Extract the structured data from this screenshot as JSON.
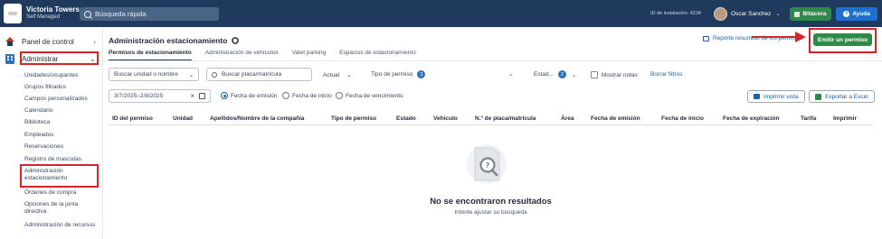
{
  "topbar": {
    "app_name": "Victoria Towers",
    "app_sub": "Self Managed",
    "search_placeholder": "Búsqueda rápida",
    "install_id": "ID de instalación: 4234",
    "user_name": "Oscar Sanchez",
    "bitacora_label": "Bitácora",
    "ayuda_label": "Ayuda",
    "brand_color": "#1f3a5c"
  },
  "sidebar": {
    "panel_label": "Panel de control",
    "admin_label": "Administrar",
    "items": [
      "Unidades/ocupantes",
      "Grupos filtrados",
      "Campos personalizados",
      "Calendario",
      "Biblioteca",
      "Empleados",
      "Reservaciones",
      "Registro de mascotas",
      "Administración estacionamiento",
      "Órdenes de compra",
      "Opciones de la junta directiva",
      "Administración de recursos"
    ]
  },
  "main": {
    "title": "Administración estacionamiento",
    "report_link": "Reporte resumido de los permisos",
    "emit_button": "Emitir un permiso",
    "tabs": [
      "Permisos de estacionamiento",
      "Administración de vehículos",
      "Valet parking",
      "Espacios de estacionamiento"
    ],
    "filters": {
      "unit_select": "Buscar unidad o nombre",
      "plate_search": "Buscar placa/matrícula",
      "actual": "Actual",
      "tipo_permiso": "Tipo de permiso",
      "tipo_count": "3",
      "estado": "Estad...",
      "estado_count": "2",
      "mostrar_notas": "Mostrar notas",
      "borrar_filtros": "Borrar filtros"
    },
    "date_range": "3/7/2025–2/8/2025",
    "radios": [
      "Fecha de emisión",
      "Fecha de inicio",
      "Fecha de vencimiento"
    ],
    "print_button": "Imprimir vista",
    "export_button": "Exportar a Excel",
    "columns": [
      "ID del permiso",
      "Unidad",
      "Apellidos/Nombre de la compañía",
      "Tipo de permiso",
      "Estado",
      "Vehículo",
      "N.º de placa/matrícula",
      "Área",
      "Fecha de emisión",
      "Fecha de inicio",
      "Fecha de expiración",
      "Tarifa",
      "Imprimir"
    ],
    "empty_title": "No se encontraron resultados",
    "empty_sub": "Intente ajustar su búsqueda"
  }
}
